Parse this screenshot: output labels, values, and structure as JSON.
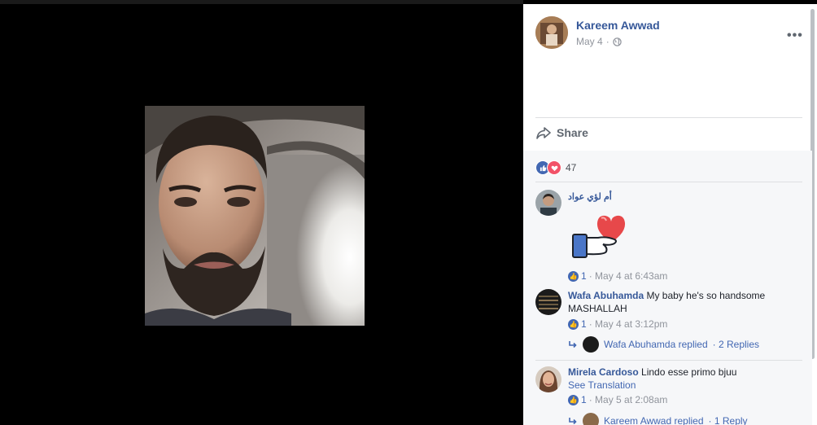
{
  "post": {
    "author": "Kareem Awwad",
    "date": "May 4",
    "dot": "·",
    "more": "•••",
    "share_label": "Share"
  },
  "reactions": {
    "count": "47"
  },
  "comments": [
    {
      "name": "أم لؤي عواد",
      "likes": "1",
      "time": "· May 4 at 6:43am"
    },
    {
      "name": "Wafa Abuhamda",
      "text_line1": "My baby he's so handsome",
      "text_line2": "MASHALLAH",
      "likes": "1",
      "time": "· May 4 at 3:12pm",
      "replied": "Wafa Abuhamda replied",
      "reply_count": "· 2 Replies"
    },
    {
      "name": "Mirela Cardoso",
      "text": "Lindo esse primo bjuu",
      "see_translation": "See Translation",
      "likes": "1",
      "time": "· May 5 at 2:08am",
      "replied": "Kareem Awwad replied",
      "reply_count": "· 1 Reply"
    }
  ],
  "colors": {
    "link": "#365899",
    "like": "#4267b2",
    "love": "#f25268"
  }
}
